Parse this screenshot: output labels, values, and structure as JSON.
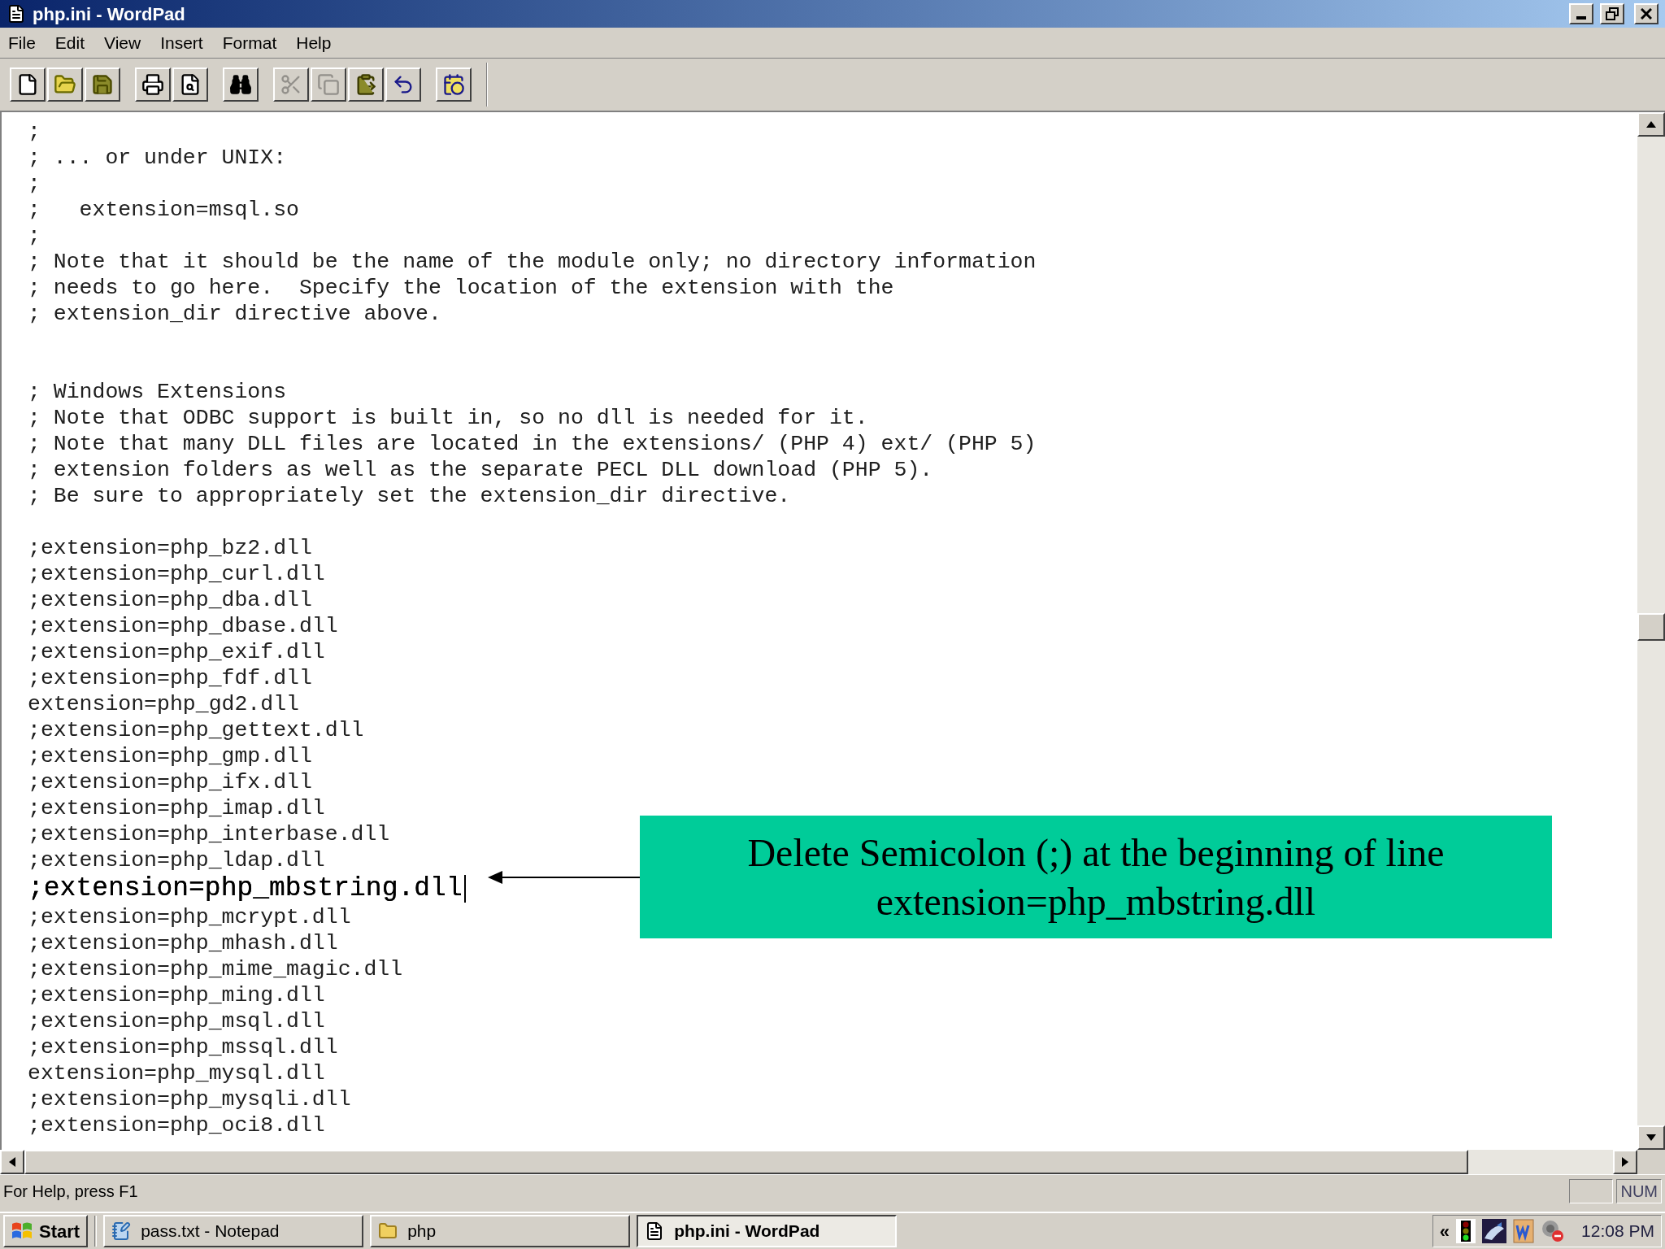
{
  "window": {
    "title": "php.ini - WordPad"
  },
  "menu": [
    {
      "label": "File"
    },
    {
      "label": "Edit"
    },
    {
      "label": "View"
    },
    {
      "label": "Insert"
    },
    {
      "label": "Format"
    },
    {
      "label": "Help"
    }
  ],
  "toolbar": [
    [
      {
        "kind": "new",
        "disabled": false
      },
      {
        "kind": "open",
        "disabled": false
      },
      {
        "kind": "save",
        "disabled": false
      }
    ],
    [
      {
        "kind": "print",
        "disabled": false
      },
      {
        "kind": "preview",
        "disabled": false
      }
    ],
    [
      {
        "kind": "find",
        "disabled": false
      }
    ],
    [
      {
        "kind": "cut",
        "disabled": true
      },
      {
        "kind": "copy",
        "disabled": true
      },
      {
        "kind": "paste",
        "disabled": false
      },
      {
        "kind": "undo",
        "disabled": false
      }
    ],
    [
      {
        "kind": "datetime",
        "disabled": false
      }
    ]
  ],
  "document": {
    "lines": [
      {
        "kind": "text",
        "text": ";"
      },
      {
        "kind": "text",
        "text": "; ... or under UNIX:"
      },
      {
        "kind": "text",
        "text": ";"
      },
      {
        "kind": "text",
        "text": ";   extension=msql.so"
      },
      {
        "kind": "text",
        "text": ";"
      },
      {
        "kind": "text",
        "text": "; Note that it should be the name of the module only; no directory information"
      },
      {
        "kind": "text",
        "text": "; needs to go here.  Specify the location of the extension with the"
      },
      {
        "kind": "text",
        "text": "; extension_dir directive above."
      },
      {
        "kind": "blank"
      },
      {
        "kind": "blank"
      },
      {
        "kind": "text",
        "text": "; Windows Extensions"
      },
      {
        "kind": "text",
        "text": "; Note that ODBC support is built in, so no dll is needed for it."
      },
      {
        "kind": "text",
        "text": "; Note that many DLL files are located in the extensions/ (PHP 4) ext/ (PHP 5)"
      },
      {
        "kind": "text",
        "text": "; extension folders as well as the separate PECL DLL download (PHP 5)."
      },
      {
        "kind": "text",
        "text": "; Be sure to appropriately set the extension_dir directive."
      },
      {
        "kind": "blank"
      },
      {
        "kind": "text",
        "text": ";extension=php_bz2.dll"
      },
      {
        "kind": "text",
        "text": ";extension=php_curl.dll"
      },
      {
        "kind": "text",
        "text": ";extension=php_dba.dll"
      },
      {
        "kind": "text",
        "text": ";extension=php_dbase.dll"
      },
      {
        "kind": "text",
        "text": ";extension=php_exif.dll"
      },
      {
        "kind": "text",
        "text": ";extension=php_fdf.dll"
      },
      {
        "kind": "text",
        "text": "extension=php_gd2.dll"
      },
      {
        "kind": "text",
        "text": ";extension=php_gettext.dll"
      },
      {
        "kind": "text",
        "text": ";extension=php_gmp.dll"
      },
      {
        "kind": "text",
        "text": ";extension=php_ifx.dll"
      },
      {
        "kind": "text",
        "text": ";extension=php_imap.dll"
      },
      {
        "kind": "text",
        "text": ";extension=php_interbase.dll"
      },
      {
        "kind": "text",
        "text": ";extension=php_ldap.dll"
      },
      {
        "kind": "current",
        "text": ";extension=php_mbstring.dll"
      },
      {
        "kind": "text",
        "text": ";extension=php_mcrypt.dll"
      },
      {
        "kind": "text",
        "text": ";extension=php_mhash.dll"
      },
      {
        "kind": "text",
        "text": ";extension=php_mime_magic.dll"
      },
      {
        "kind": "text",
        "text": ";extension=php_ming.dll"
      },
      {
        "kind": "text",
        "text": ";extension=php_msql.dll"
      },
      {
        "kind": "text",
        "text": ";extension=php_mssql.dll"
      },
      {
        "kind": "text",
        "text": "extension=php_mysql.dll"
      },
      {
        "kind": "text",
        "text": ";extension=php_mysqli.dll"
      },
      {
        "kind": "text",
        "text": ";extension=php_oci8.dll"
      }
    ]
  },
  "callout": {
    "lines": [
      "Delete Semicolon (;) at the beginning of line",
      "extension=php_mbstring.dll"
    ]
  },
  "status_bar": {
    "text": "For Help, press F1",
    "indicators": [
      {
        "text": "NUM"
      }
    ]
  },
  "taskbar": {
    "start": "Start",
    "tasks": [
      {
        "kind": "notepad",
        "label": "pass.txt - Notepad",
        "selected": false
      },
      {
        "kind": "folder",
        "label": "php",
        "selected": false
      },
      {
        "kind": "wordpad",
        "label": "php.ini - WordPad",
        "selected": true
      }
    ],
    "tray_toggle": "«",
    "clock": "12:08 PM"
  }
}
